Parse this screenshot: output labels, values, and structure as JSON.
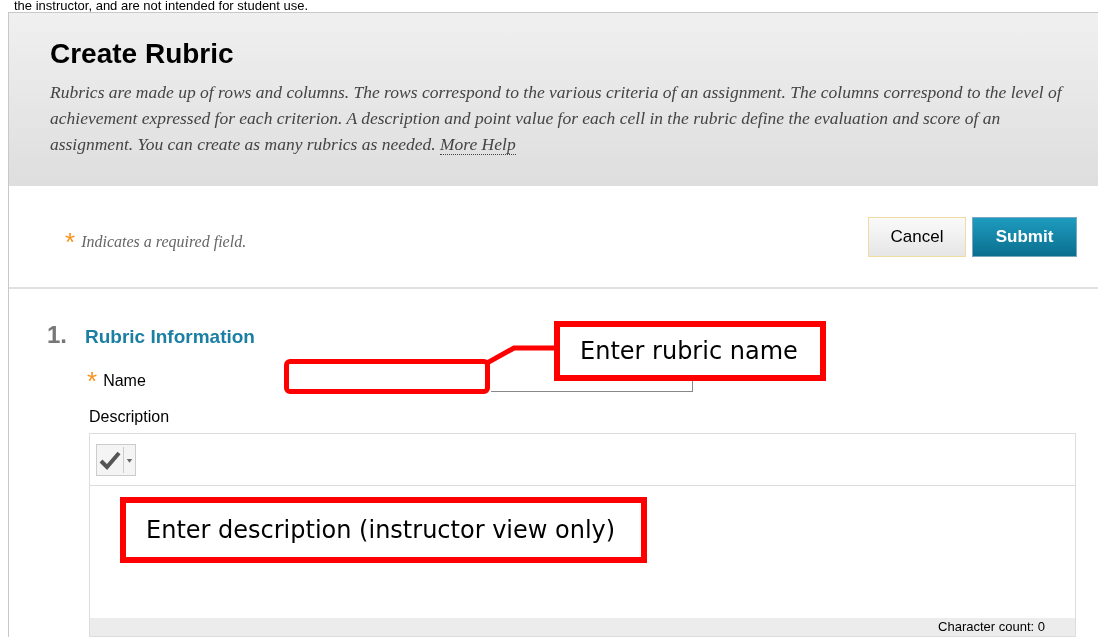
{
  "top_text": "the instructor, and are not intended for student use.",
  "header": {
    "title": "Create Rubric",
    "description": "Rubrics are made up of rows and columns. The rows correspond to the various criteria of an assignment. The columns correspond to the level of achievement expressed for each criterion. A description and point value for each cell in the rubric define the evaluation and score of an assignment. You can create as many rubrics as needed.",
    "help_link": "More Help"
  },
  "required_note": {
    "mark": "*",
    "text": "Indicates a required field."
  },
  "buttons": [
    {
      "label": "Cancel",
      "kind": "secondary"
    },
    {
      "label": "Submit",
      "kind": "primary"
    }
  ],
  "section": {
    "number": "1.",
    "title": "Rubric Information"
  },
  "fields": [
    {
      "label": "Name",
      "required": true
    },
    {
      "label": "Description",
      "required": false
    }
  ],
  "editor": {
    "footer": "Character count: 0"
  },
  "annotations": [
    {
      "text": "Enter rubric name"
    },
    {
      "text": "Enter description (instructor view only)"
    }
  ]
}
